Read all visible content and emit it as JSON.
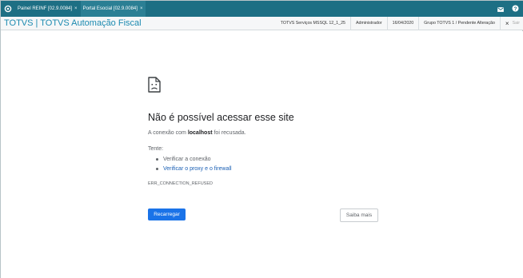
{
  "colors": {
    "tabbar": "#1d6f84",
    "title": "#1b8ab0",
    "primary_button": "#1a73e8",
    "link": "#1a5fb4"
  },
  "tabs": [
    {
      "label": "Painel REINF [02.9.0084]",
      "close": "×"
    },
    {
      "label": "Portal Esocial [02.9.0084]",
      "close": "×"
    }
  ],
  "tabbar_icons": [
    "home-icon",
    "mail-icon",
    "help-icon"
  ],
  "header": {
    "title": "TOTVS | TOTVS Automação Fiscal",
    "items": [
      "TOTVS Serviços MSSQL 12_1_25",
      "Administrador",
      "16/04/2020",
      "Grupo TOTVS 1 / Pendente Alteração"
    ],
    "exit_icon": "×",
    "exit_label": "Sair"
  },
  "error": {
    "icon": "sad-document-icon",
    "title": "Não é possível acessar esse site",
    "desc_prefix": "A conexão com ",
    "desc_host": "localhost",
    "desc_suffix": " foi recusada.",
    "try_label": "Tente:",
    "suggestions": [
      "Verificar a conexão",
      "Verificar o proxy e o firewall"
    ],
    "code": "ERR_CONNECTION_REFUSED",
    "reload_button": "Recarregar",
    "more_button": "Saiba mais"
  }
}
